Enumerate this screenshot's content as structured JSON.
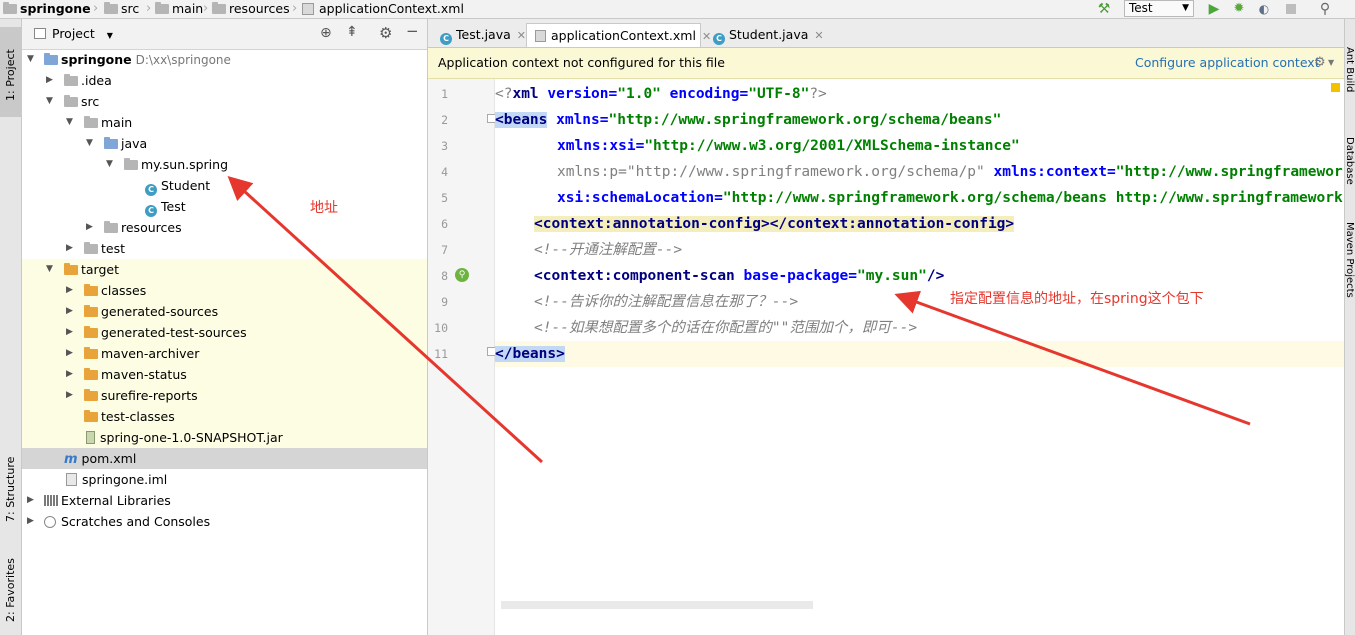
{
  "breadcrumb": [
    "springone",
    "src",
    "main",
    "resources",
    "applicationContext.xml"
  ],
  "toolbar": {
    "run_config": "Test"
  },
  "left_stripe": {
    "project": "1: Project",
    "structure": "7: Structure",
    "favorites": "2: Favorites"
  },
  "right_stripe": {
    "ant": "Ant Build",
    "database": "Database",
    "maven": "Maven Projects"
  },
  "project_panel": {
    "title": "Project",
    "root": {
      "name": "springone",
      "path": "D:\\xx\\springone"
    },
    "items": [
      ".idea",
      "src",
      "main",
      "java",
      "my.sun.spring",
      "Student",
      "Test",
      "resources",
      "test",
      "target",
      "classes",
      "generated-sources",
      "generated-test-sources",
      "maven-archiver",
      "maven-status",
      "surefire-reports",
      "test-classes",
      "spring-one-1.0-SNAPSHOT.jar",
      "pom.xml",
      "springone.iml",
      "External Libraries",
      "Scratches and Consoles"
    ]
  },
  "editor": {
    "tabs": [
      "Test.java",
      "applicationContext.xml",
      "Student.java"
    ],
    "banner_message": "Application context not configured for this file",
    "banner_link": "Configure application context",
    "line_numbers": [
      "1",
      "2",
      "3",
      "4",
      "5",
      "6",
      "7",
      "8",
      "9",
      "10",
      "11"
    ],
    "code": {
      "l1": {
        "a": "<?",
        "b": "xml",
        "c": " version=",
        "d": "\"1.0\"",
        "e": " encoding=",
        "f": "\"UTF-8\"",
        "g": "?>"
      },
      "l2": {
        "a": "<beans",
        "b": " xmlns=",
        "c": "\"http://www.springframework.org/schema/beans\""
      },
      "l3": {
        "a": "xmlns:xsi=",
        "b": "\"http://www.w3.org/2001/XMLSchema-instance\""
      },
      "l4": {
        "a": "xmlns:p=\"http://www.springframework.org/schema/p\"",
        "b": " xmlns:context=",
        "c": "\"http://www.springframework.org/schema/context\""
      },
      "l5": {
        "a": "xsi:schemaLocation=",
        "b": "\"http://www.springframework.org/schema/beans http://www.springframework.org/schema/beans/spring-beans.xsd\""
      },
      "l6": {
        "a": "<context:annotation-config>",
        "b": "</context:annotation-config>"
      },
      "l7": "<!--开通注解配置-->",
      "l8": {
        "a": "<context:component-scan",
        "b": " base-package=",
        "c": "\"my.sun\"",
        "d": "/>"
      },
      "l9": "<!--告诉你的注解配置信息在那了？-->",
      "l10": "<!--如果想配置多个的话在你配置的\"\"范围加个，即可-->",
      "l11": "</beans>"
    }
  },
  "annotations": {
    "address": "地址",
    "note": "指定配置信息的地址，在spring这个包下"
  },
  "colors": {
    "annotation": "#e6372e",
    "selection": "#d5d5d5",
    "banner": "#fbf8d6"
  }
}
